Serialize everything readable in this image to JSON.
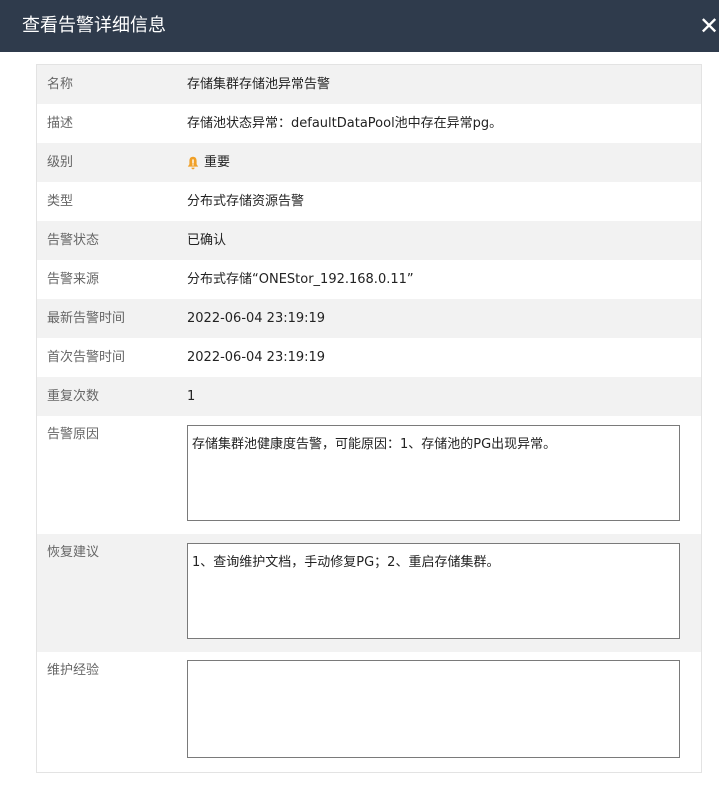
{
  "dialog": {
    "title": "查看告警详细信息",
    "close_symbol": "✕"
  },
  "fields": {
    "name": {
      "label": "名称",
      "value": "存储集群存储池异常告警"
    },
    "description": {
      "label": "描述",
      "value": "存储池状态异常：defaultDataPool池中存在异常pg。"
    },
    "level": {
      "label": "级别",
      "value": "重要",
      "icon": "bell-icon",
      "icon_color": "#f0a028"
    },
    "type": {
      "label": "类型",
      "value": "分布式存储资源告警"
    },
    "status": {
      "label": "告警状态",
      "value": "已确认"
    },
    "source": {
      "label": "告警来源",
      "value": "分布式存储“ONEStor_192.168.0.11”"
    },
    "latest_time": {
      "label": "最新告警时间",
      "value": "2022-06-04 23:19:19"
    },
    "first_time": {
      "label": "首次告警时间",
      "value": "2022-06-04 23:19:19"
    },
    "repeat_count": {
      "label": "重复次数",
      "value": "1"
    },
    "cause": {
      "label": "告警原因",
      "value": "存储集群池健康度告警，可能原因：1、存储池的PG出现异常。"
    },
    "suggestion": {
      "label": "恢复建议",
      "value": "1、查询维护文档，手动修复PG；2、重启存储集群。"
    },
    "experience": {
      "label": "维护经验",
      "value": ""
    }
  },
  "colors": {
    "header_bg": "#2f3b4c",
    "row_alt_bg": "#f2f2f2",
    "label_text": "#666666",
    "value_text": "#222222",
    "warning_icon": "#f0a028"
  }
}
